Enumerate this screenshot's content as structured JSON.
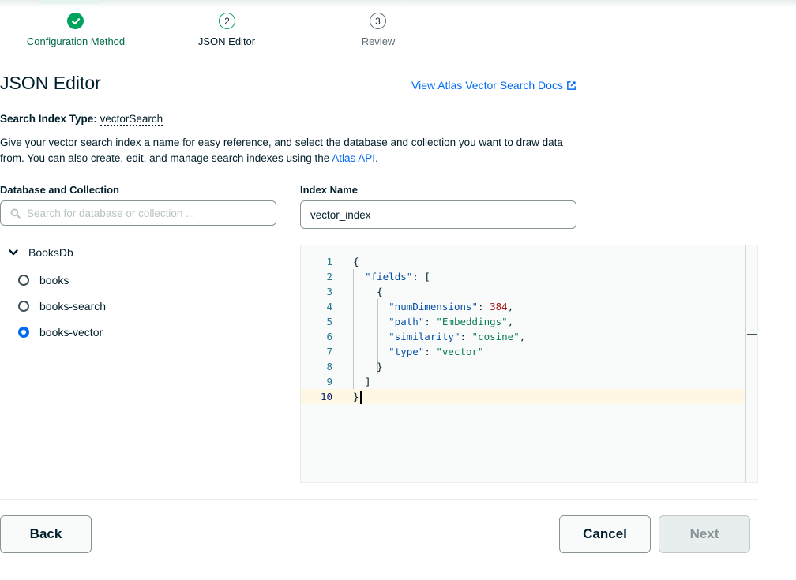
{
  "stepper": {
    "steps": [
      {
        "number": "1",
        "label": "Configuration Method",
        "state": "complete"
      },
      {
        "number": "2",
        "label": "JSON Editor",
        "state": "current"
      },
      {
        "number": "3",
        "label": "Review",
        "state": "upcoming"
      }
    ]
  },
  "header": {
    "title": "JSON Editor",
    "docs_link": "View Atlas Vector Search Docs"
  },
  "index_type": {
    "label": "Search Index Type:",
    "value": "vectorSearch"
  },
  "description": {
    "text": "Give your vector search index a name for easy reference, and select the database and collection you want to draw data from. You can also create, edit, and manage search indexes using the ",
    "link": "Atlas API",
    "suffix": "."
  },
  "database_collection": {
    "label": "Database and Collection",
    "search_placeholder": "Search for database or collection ...",
    "database": "BooksDb",
    "collections": [
      {
        "name": "books",
        "selected": false
      },
      {
        "name": "books-search",
        "selected": false
      },
      {
        "name": "books-vector",
        "selected": true
      }
    ]
  },
  "index_name": {
    "label": "Index Name",
    "value": "vector_index"
  },
  "editor": {
    "active_line": 10,
    "lines": [
      {
        "n": "1",
        "tokens": [
          {
            "t": "{",
            "c": "punc"
          }
        ]
      },
      {
        "n": "2",
        "tokens": [
          {
            "t": "  ",
            "c": "punc"
          },
          {
            "t": "\"fields\"",
            "c": "key"
          },
          {
            "t": ": [",
            "c": "punc"
          }
        ]
      },
      {
        "n": "3",
        "tokens": [
          {
            "t": "    {",
            "c": "punc"
          }
        ]
      },
      {
        "n": "4",
        "tokens": [
          {
            "t": "      ",
            "c": "punc"
          },
          {
            "t": "\"numDimensions\"",
            "c": "key"
          },
          {
            "t": ": ",
            "c": "punc"
          },
          {
            "t": "384",
            "c": "num"
          },
          {
            "t": ",",
            "c": "punc"
          }
        ]
      },
      {
        "n": "5",
        "tokens": [
          {
            "t": "      ",
            "c": "punc"
          },
          {
            "t": "\"path\"",
            "c": "key"
          },
          {
            "t": ": ",
            "c": "punc"
          },
          {
            "t": "\"Embeddings\"",
            "c": "str"
          },
          {
            "t": ",",
            "c": "punc"
          }
        ]
      },
      {
        "n": "6",
        "tokens": [
          {
            "t": "      ",
            "c": "punc"
          },
          {
            "t": "\"similarity\"",
            "c": "key"
          },
          {
            "t": ": ",
            "c": "punc"
          },
          {
            "t": "\"cosine\"",
            "c": "str"
          },
          {
            "t": ",",
            "c": "punc"
          }
        ]
      },
      {
        "n": "7",
        "tokens": [
          {
            "t": "      ",
            "c": "punc"
          },
          {
            "t": "\"type\"",
            "c": "key"
          },
          {
            "t": ": ",
            "c": "punc"
          },
          {
            "t": "\"vector\"",
            "c": "str"
          }
        ]
      },
      {
        "n": "8",
        "tokens": [
          {
            "t": "    }",
            "c": "punc"
          }
        ]
      },
      {
        "n": "9",
        "tokens": [
          {
            "t": "  ]",
            "c": "punc"
          }
        ]
      },
      {
        "n": "10",
        "tokens": [
          {
            "t": "}",
            "c": "punc"
          }
        ]
      }
    ]
  },
  "footer": {
    "back_label": "Back",
    "cancel_label": "Cancel",
    "next_label": "Next"
  },
  "colors": {
    "accent_green": "#00a35c",
    "link_blue": "#016bf8",
    "text_dark": "#001e2b"
  }
}
